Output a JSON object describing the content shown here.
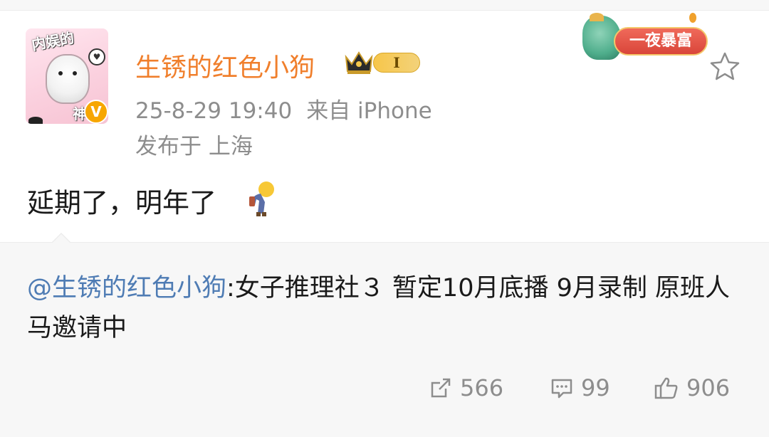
{
  "user": {
    "name": "生锈的红色小狗",
    "level": "I",
    "avatar_text_top": "内娱的",
    "avatar_text_bottom": "神",
    "verify_mark": "V"
  },
  "post": {
    "timestamp": "25-8-29 19:40",
    "source_label": "来自 iPhone",
    "location": "发布于 上海",
    "text": "延期了，明年了",
    "emoji_icon": "person-bowing-emoji"
  },
  "decoration": {
    "banner_text": "一夜暴富"
  },
  "repost": {
    "mention": "@生锈的红色小狗",
    "text": ":女子推理社３ 暂定10月底播 9月录制 原班人马邀请中"
  },
  "stats": {
    "reposts": "566",
    "comments": "99",
    "likes": "906"
  },
  "colors": {
    "username": "#f07f2c",
    "mention": "#4f7cb4",
    "meta": "#8d8d8d",
    "badge": "#f7a600",
    "repost_bg": "#f7f7f7"
  }
}
